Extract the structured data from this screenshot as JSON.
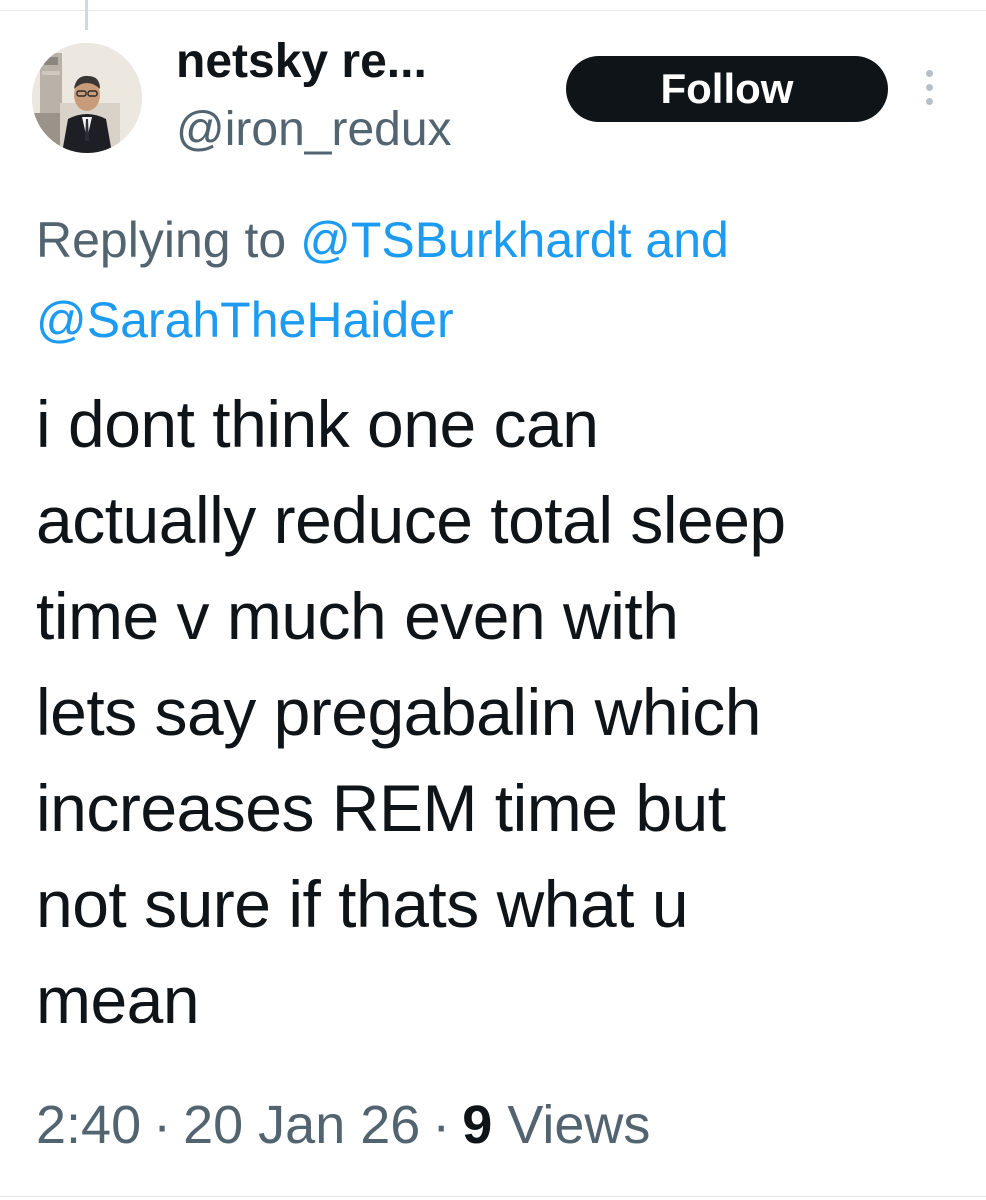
{
  "author": {
    "display_name": "netsky re...",
    "handle": "@iron_redux"
  },
  "actions": {
    "follow_label": "Follow",
    "more_icon": "more-vertical-icon"
  },
  "reply_context": {
    "prefix": "Replying to",
    "mention_1": "@TSBurkhardt",
    "conjunction": "and",
    "mention_2": "@SarahTheHaider"
  },
  "tweet": {
    "text": "i dont think one can\nactually reduce total sleep\ntime v much even with\nlets say pregabalin which\nincreases REM time but\nnot sure if thats what  u\nmean",
    "time": "2:40",
    "date": "20 Jan 26",
    "views_count": "9",
    "views_label": "Views"
  },
  "colors": {
    "text_primary": "#0f1419",
    "text_secondary": "#536471",
    "link": "#1d9bf0",
    "button_bg": "#0f1419",
    "button_text": "#ffffff"
  }
}
